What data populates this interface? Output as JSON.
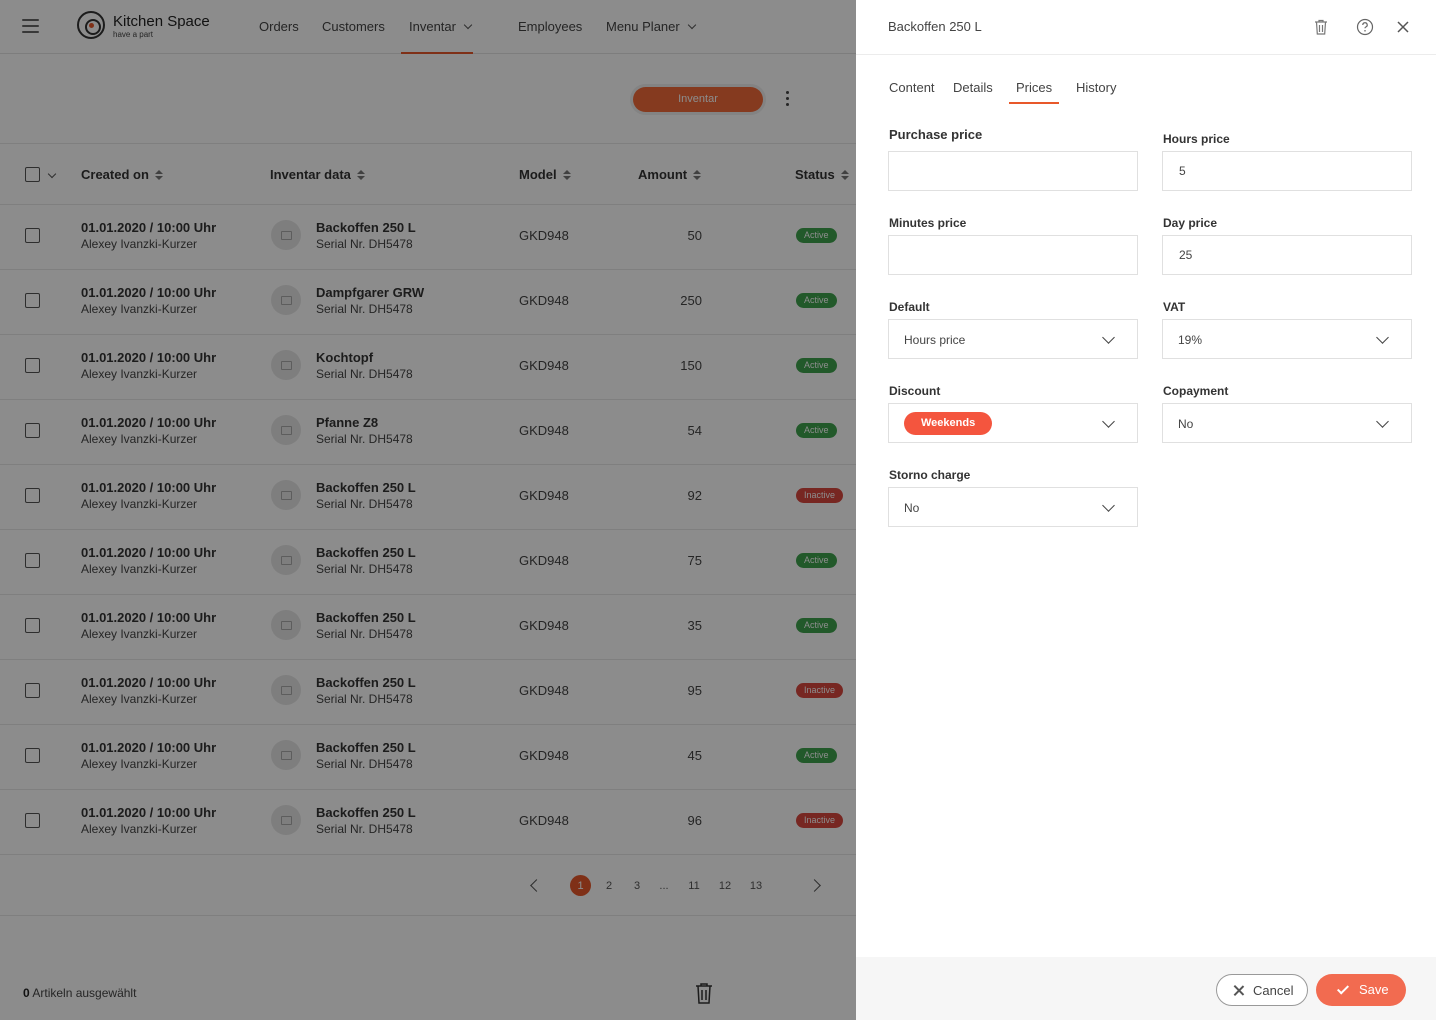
{
  "app": {
    "logo_name": "Kitchen Space",
    "logo_tagline": "have a part",
    "nav": [
      "Orders",
      "Customers",
      "Inventar",
      "Employees",
      "Menu Planer"
    ],
    "toolbar_button": "Inventar",
    "columns": [
      "Created on",
      "Inventar data",
      "Model",
      "Amount",
      "Status"
    ],
    "rows": [
      {
        "date": "01.01.2020  /  10:00 Uhr",
        "user": "Alexey Ivanzki-Kurzer",
        "name": "Backoffen 250 L",
        "serial": "Serial Nr. DH5478",
        "model": "GKD948",
        "amount": "50",
        "status": "Active"
      },
      {
        "date": "01.01.2020  /  10:00 Uhr",
        "user": "Alexey Ivanzki-Kurzer",
        "name": "Dampfgarer GRW",
        "serial": "Serial Nr. DH5478",
        "model": "GKD948",
        "amount": "250",
        "status": "Active"
      },
      {
        "date": "01.01.2020  /  10:00 Uhr",
        "user": "Alexey Ivanzki-Kurzer",
        "name": "Kochtopf",
        "serial": "Serial Nr. DH5478",
        "model": "GKD948",
        "amount": "150",
        "status": "Active"
      },
      {
        "date": "01.01.2020  /  10:00 Uhr",
        "user": "Alexey Ivanzki-Kurzer",
        "name": "Pfanne Z8",
        "serial": "Serial Nr. DH5478",
        "model": "GKD948",
        "amount": "54",
        "status": "Active"
      },
      {
        "date": "01.01.2020  /  10:00 Uhr",
        "user": "Alexey Ivanzki-Kurzer",
        "name": "Backoffen 250 L",
        "serial": "Serial Nr. DH5478",
        "model": "GKD948",
        "amount": "92",
        "status": "Inactive"
      },
      {
        "date": "01.01.2020  /  10:00 Uhr",
        "user": "Alexey Ivanzki-Kurzer",
        "name": "Backoffen 250 L",
        "serial": "Serial Nr. DH5478",
        "model": "GKD948",
        "amount": "75",
        "status": "Active"
      },
      {
        "date": "01.01.2020  /  10:00 Uhr",
        "user": "Alexey Ivanzki-Kurzer",
        "name": "Backoffen 250 L",
        "serial": "Serial Nr. DH5478",
        "model": "GKD948",
        "amount": "35",
        "status": "Active"
      },
      {
        "date": "01.01.2020  /  10:00 Uhr",
        "user": "Alexey Ivanzki-Kurzer",
        "name": "Backoffen 250 L",
        "serial": "Serial Nr. DH5478",
        "model": "GKD948",
        "amount": "95",
        "status": "Inactive"
      },
      {
        "date": "01.01.2020  /  10:00 Uhr",
        "user": "Alexey Ivanzki-Kurzer",
        "name": "Backoffen 250 L",
        "serial": "Serial Nr. DH5478",
        "model": "GKD948",
        "amount": "45",
        "status": "Active"
      },
      {
        "date": "01.01.2020  /  10:00 Uhr",
        "user": "Alexey Ivanzki-Kurzer",
        "name": "Backoffen 250 L",
        "serial": "Serial Nr. DH5478",
        "model": "GKD948",
        "amount": "96",
        "status": "Inactive"
      }
    ],
    "pagination": [
      "1",
      "2",
      "3",
      "...",
      "11",
      "12",
      "13"
    ],
    "current_page": "1",
    "selected_count": "0",
    "selected_label": "Artikeln ausgewählt"
  },
  "drawer": {
    "title": "Backoffen 250 L",
    "tabs": [
      "Content",
      "Details",
      "Prices",
      "History"
    ],
    "active_tab": "Prices",
    "fields": {
      "purchase_price": {
        "label": "Purchase price",
        "value": ""
      },
      "hours_price": {
        "label": "Hours price",
        "value": "5"
      },
      "minutes_price": {
        "label": "Minutes price",
        "value": ""
      },
      "day_price": {
        "label": "Day price",
        "value": "25"
      },
      "default": {
        "label": "Default",
        "value": "Hours price"
      },
      "vat": {
        "label": "VAT",
        "value": "19%"
      },
      "discount": {
        "label": "Discount",
        "value": "Weekends"
      },
      "copayment": {
        "label": "Copayment",
        "value": "No"
      },
      "storno_charge": {
        "label": "Storno charge",
        "value": "No"
      }
    },
    "cancel_label": "Cancel",
    "save_label": "Save"
  },
  "colors": {
    "accent": "#e8582a",
    "chip": "#f4553e",
    "save": "#f26b50",
    "active": "#3fa34d",
    "inactive": "#d9473f"
  },
  "icons": [
    "menu-icon",
    "logo-icon",
    "chevron-down-icon",
    "kebab-icon",
    "sort-icon",
    "image-icon",
    "chevron-left-icon",
    "chevron-right-icon",
    "trash-icon",
    "help-icon",
    "close-icon",
    "check-icon"
  ]
}
